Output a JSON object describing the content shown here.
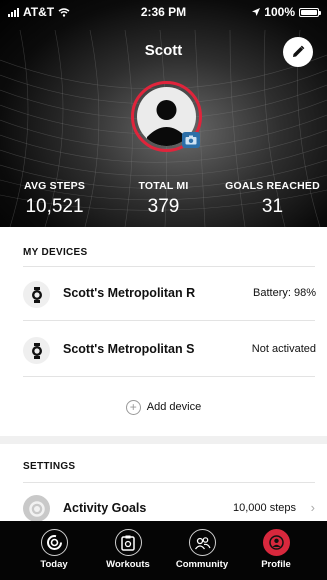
{
  "status_bar": {
    "carrier": "AT&T",
    "time": "2:36 PM",
    "battery": "100%"
  },
  "profile": {
    "name": "Scott"
  },
  "stats": [
    {
      "label": "AVG STEPS",
      "value": "10,521"
    },
    {
      "label": "TOTAL MI",
      "value": "379"
    },
    {
      "label": "GOALS REACHED",
      "value": "31"
    }
  ],
  "devices_section": {
    "title": "MY DEVICES",
    "items": [
      {
        "name": "Scott's Metropolitan R",
        "status": "Battery: 98%",
        "icon": "watch-icon"
      },
      {
        "name": "Scott's Metropolitan S",
        "status": "Not activated",
        "icon": "watch-icon"
      }
    ],
    "add_label": "Add device"
  },
  "settings_section": {
    "title": "SETTINGS",
    "items": [
      {
        "name": "Activity Goals",
        "value": "10,000 steps",
        "icon": "activity-ring-icon"
      }
    ]
  },
  "tabs": [
    {
      "label": "Today",
      "icon": "today-ring-icon",
      "active": false
    },
    {
      "label": "Workouts",
      "icon": "workouts-icon",
      "active": false
    },
    {
      "label": "Community",
      "icon": "community-icon",
      "active": false
    },
    {
      "label": "Profile",
      "icon": "profile-icon",
      "active": true
    }
  ],
  "colors": {
    "accent": "#d8283d",
    "header_bg": "#0b0b0b",
    "camera": "#2c6fa8"
  }
}
